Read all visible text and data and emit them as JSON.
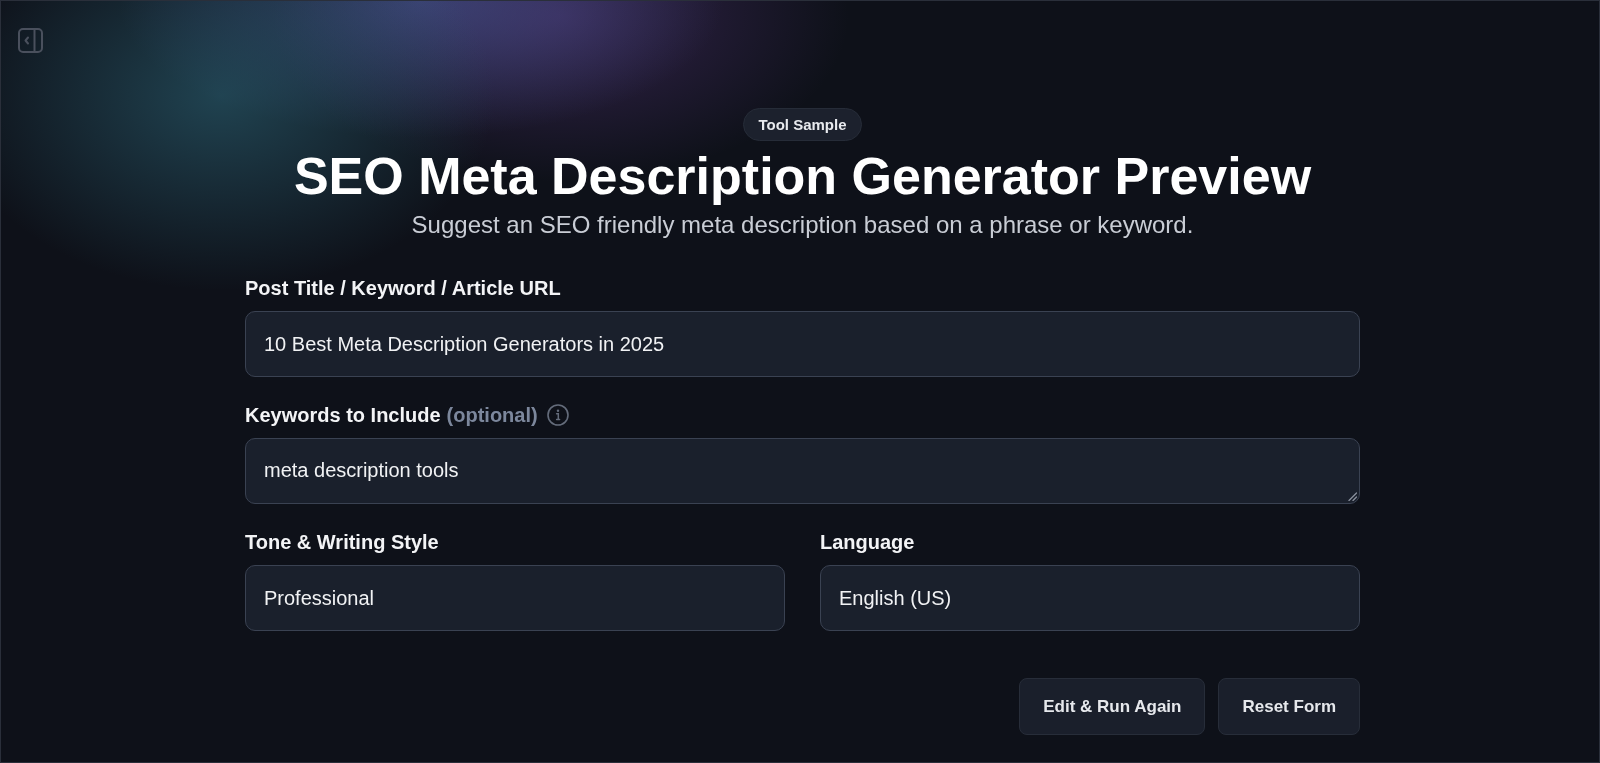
{
  "header": {
    "badge": "Tool Sample",
    "title": "SEO Meta Description Generator Preview",
    "subtitle": "Suggest an SEO friendly meta description based on a phrase or keyword."
  },
  "form": {
    "rows": [
      {
        "fields": [
          {
            "kind": "input",
            "label": "Post Title / Keyword / Article URL",
            "value": "10 Best Meta Description Generators in 2025"
          }
        ]
      },
      {
        "fields": [
          {
            "kind": "textarea",
            "label": "Keywords to Include",
            "note": "(optional)",
            "info": true,
            "value": "meta description tools"
          }
        ]
      },
      {
        "fields": [
          {
            "kind": "select",
            "label": "Tone & Writing Style",
            "value": "Professional"
          },
          {
            "kind": "select",
            "label": "Language",
            "value": "English (US)"
          }
        ]
      }
    ]
  },
  "buttons": [
    "Edit & Run Again",
    "Reset Form"
  ]
}
